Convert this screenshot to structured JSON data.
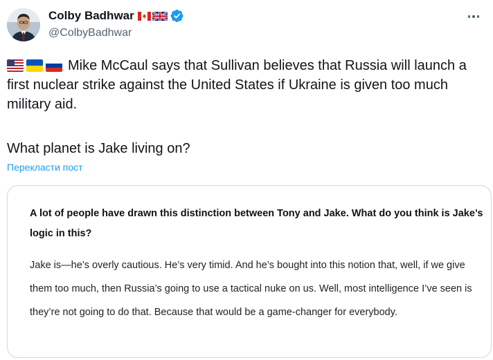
{
  "author": {
    "name": "Colby Badhwar",
    "handle": "@ColbyBadhwar",
    "name_flags": [
      "canada-flag-icon",
      "uk-flag-icon"
    ],
    "verified_icon": "verified-badge-icon"
  },
  "tweet": {
    "leading_flags": [
      "us-flag-icon",
      "ukraine-flag-icon",
      "russia-flag-icon"
    ],
    "text_paragraph_1": "Mike McCaul says that Sullivan believes that Russia will launch a first nuclear strike against the United States if Ukraine is given too much military aid.",
    "text_paragraph_2": "What planet is Jake living on?",
    "translate_label": "Перекласти пост"
  },
  "quote": {
    "question": "A lot of people have drawn this distinction between Tony and Jake. What do you think is Jake’s logic in this?",
    "answer": "Jake is—he’s overly cautious. He’s very timid. And he’s bought into this notion that, well, if we give them too much, then Russia’s going to use a tactical nuke on us. Well, most intelligence I’ve seen is they’re not going to do that. Because that would be a game-changer for everybody."
  },
  "colors": {
    "text": "#0f1419",
    "secondary": "#536471",
    "link": "#1d9bf0",
    "verified": "#1d9bf0",
    "card_border": "#cfd9de"
  }
}
